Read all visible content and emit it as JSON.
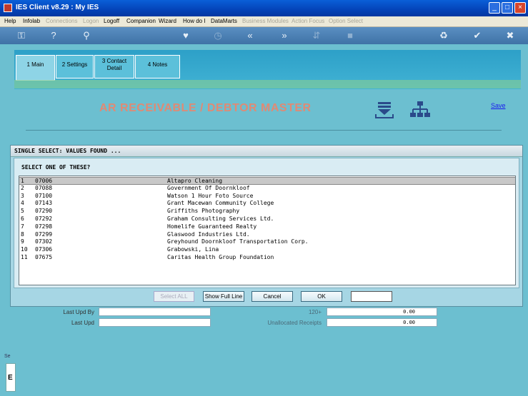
{
  "window": {
    "title": "IES Client v8.29 : My IES"
  },
  "menu": {
    "items": [
      "Help",
      "Infolab",
      "Connections",
      "Logon",
      "Logoff",
      "Companion",
      "Wizard",
      "How do I",
      "DataMarts",
      "Business Modules",
      "Action Focus",
      "Option Select"
    ],
    "disabled": [
      "Connections",
      "Logon",
      "Business Modules",
      "Action Focus",
      "Option Select"
    ]
  },
  "tabs": [
    {
      "label": "1 Main"
    },
    {
      "label": "2 Settings"
    },
    {
      "label": "3 Contact Detail"
    },
    {
      "label": "4 Notes"
    }
  ],
  "header": {
    "title": "AR RECEIVABLE / DEBTOR MASTER",
    "save_label": "Save"
  },
  "dialog": {
    "title": "SINGLE SELECT: VALUES FOUND ...",
    "prompt": "SELECT ONE OF THESE?",
    "rows": [
      {
        "num": "1",
        "code": "07006",
        "name": "Altapro Cleaning"
      },
      {
        "num": "2",
        "code": "07088",
        "name": "Government Of Doornkloof"
      },
      {
        "num": "3",
        "code": "07100",
        "name": "Watson 1 Hour Foto Source"
      },
      {
        "num": "4",
        "code": "07143",
        "name": "Grant Macewan Community College"
      },
      {
        "num": "5",
        "code": "07290",
        "name": "Griffiths Photography"
      },
      {
        "num": "6",
        "code": "07292",
        "name": "Graham Consulting Services Ltd."
      },
      {
        "num": "7",
        "code": "07298",
        "name": "Homelife Guaranteed Realty"
      },
      {
        "num": "8",
        "code": "07299",
        "name": "Glaswood Industries Ltd."
      },
      {
        "num": "9",
        "code": "07302",
        "name": "Greyhound Doornkloof Transportation Corp."
      },
      {
        "num": "10",
        "code": "07306",
        "name": "Grabowski, Lina"
      },
      {
        "num": "11",
        "code": "07675",
        "name": "Caritas Health Group Foundation"
      }
    ],
    "buttons": {
      "select_all": "Select ALL",
      "show_full_line": "Show Full Line",
      "cancel": "Cancel",
      "ok": "OK"
    }
  },
  "fields": {
    "last_upd_by": "Last Upd By",
    "last_upd": "Last Upd",
    "aging_120": "120+",
    "aging_120_value": "0.00",
    "unallocated": "Unallocated Receipts",
    "unallocated_value": "0.00"
  },
  "side": {
    "letter": "E",
    "tiny": "Se"
  }
}
